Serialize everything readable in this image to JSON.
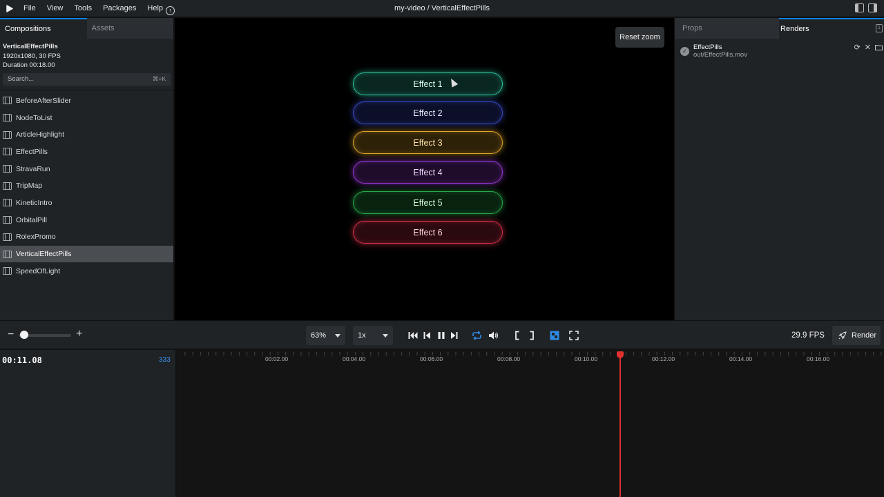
{
  "menubar": {
    "items": [
      "File",
      "View",
      "Tools",
      "Packages",
      "Help"
    ],
    "title": "my-video / VerticalEffectPills"
  },
  "left_panel": {
    "tabs": [
      "Compositions",
      "Assets"
    ],
    "composition": {
      "name": "VerticalEffectPills",
      "resolution": "1920x1080, 30 FPS",
      "duration": "Duration 00:18.00"
    },
    "search": {
      "placeholder": "Search...",
      "shortcut": "⌘+K"
    },
    "items": [
      {
        "label": "BeforeAfterSlider"
      },
      {
        "label": "NodeToList"
      },
      {
        "label": "ArticleHighlight"
      },
      {
        "label": "EffectPills"
      },
      {
        "label": "StravaRun"
      },
      {
        "label": "TripMap"
      },
      {
        "label": "KineticIntro"
      },
      {
        "label": "OrbitalPill"
      },
      {
        "label": "RolexPromo"
      },
      {
        "label": "VerticalEffectPills"
      },
      {
        "label": "SpeedOfLight"
      }
    ],
    "selected_item": "VerticalEffectPills"
  },
  "preview": {
    "reset_zoom_label": "Reset zoom",
    "pills": [
      {
        "label": "Effect 1",
        "color": "#2ec4a0",
        "text_color": "#d8fff2"
      },
      {
        "label": "Effect 2",
        "color": "#3a4cc8",
        "text_color": "#e6e8ff"
      },
      {
        "label": "Effect 3",
        "color": "#e0a52a",
        "text_color": "#ffe3a8"
      },
      {
        "label": "Effect 4",
        "color": "#9a3ad6",
        "text_color": "#f0d8ff"
      },
      {
        "label": "Effect 5",
        "color": "#2aa84a",
        "text_color": "#d2ffd8"
      },
      {
        "label": "Effect 6",
        "color": "#d6304a",
        "text_color": "#ffd2d8"
      }
    ]
  },
  "right_panel": {
    "tabs": [
      "Props",
      "Renders"
    ],
    "badge": "1",
    "render": {
      "name": "EffectPills",
      "path": "out/EffectPills.mov"
    }
  },
  "controls": {
    "zoom_level": "63%",
    "playback_rate": "1x",
    "fps": "29.9 FPS",
    "render_label": "Render",
    "zoom_slider_value": 0.1
  },
  "timeline": {
    "timecode": "00:11.08",
    "frame": "333",
    "ruler_labels": [
      "00:02.00",
      "00:04.00",
      "00:06.00",
      "00:08.00",
      "00:10.00",
      "00:12.00",
      "00:14.00",
      "00:16.00"
    ]
  }
}
